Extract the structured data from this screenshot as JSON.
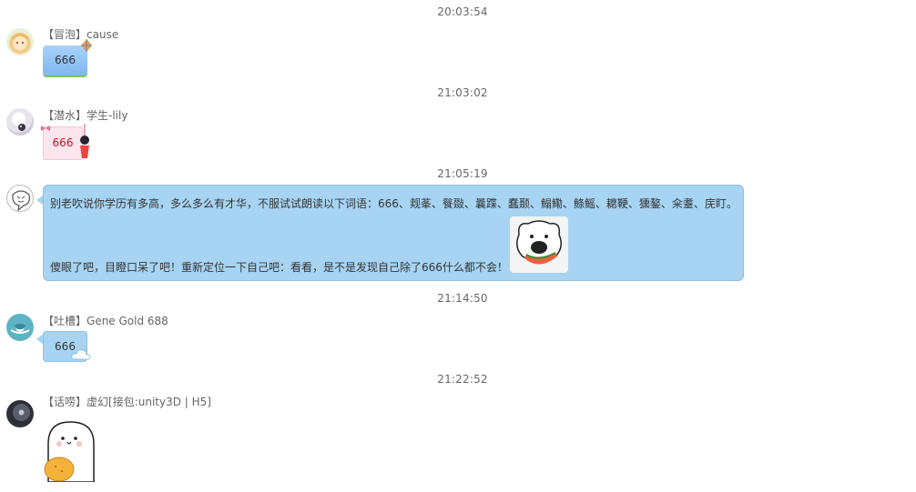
{
  "messages": [
    {
      "time": "20:03:54",
      "badge": "【冒泡】",
      "name": "cause",
      "text": "666",
      "avatar_icon": "avatar-anime-girl"
    },
    {
      "time": "21:03:02",
      "badge": "【潜水】",
      "name": "学生-lily",
      "text": "666",
      "avatar_icon": "avatar-girl-sketch"
    },
    {
      "time": "21:05:19",
      "badge": "",
      "name": "",
      "line1": "别老吹说你学历有多高，多么多么有才华，不服试试朗读以下词语：666、觌莑、餮敠、曩蹀、蠢颞、鳎鳓、鲦鳐、耱鞕、獯鏊、籴耋、庑盯。",
      "line2": "傻眼了吧，目瞪口呆了吧！重新定位一下自己吧：看看，是不是发现自己除了666什么都不会！",
      "sticker_icon": "bear-eating-watermelon-sticker",
      "avatar_icon": "avatar-doodle"
    },
    {
      "time": "21:14:50",
      "badge": "【吐槽】",
      "name": "Gene Gold 688",
      "text": "666",
      "avatar_icon": "avatar-penguin-logo"
    },
    {
      "time": "21:22:52",
      "badge": "【话唠】",
      "name": "虚幻[接包:unity3D | H5]",
      "sticker_icon": "bun-character-eating-sticker",
      "avatar_icon": "avatar-dark-photo"
    }
  ],
  "colors": {
    "bubble_blue": "#a7d4f2",
    "bubble_pink": "#fde5ee",
    "timestamp_gray": "#666666"
  }
}
